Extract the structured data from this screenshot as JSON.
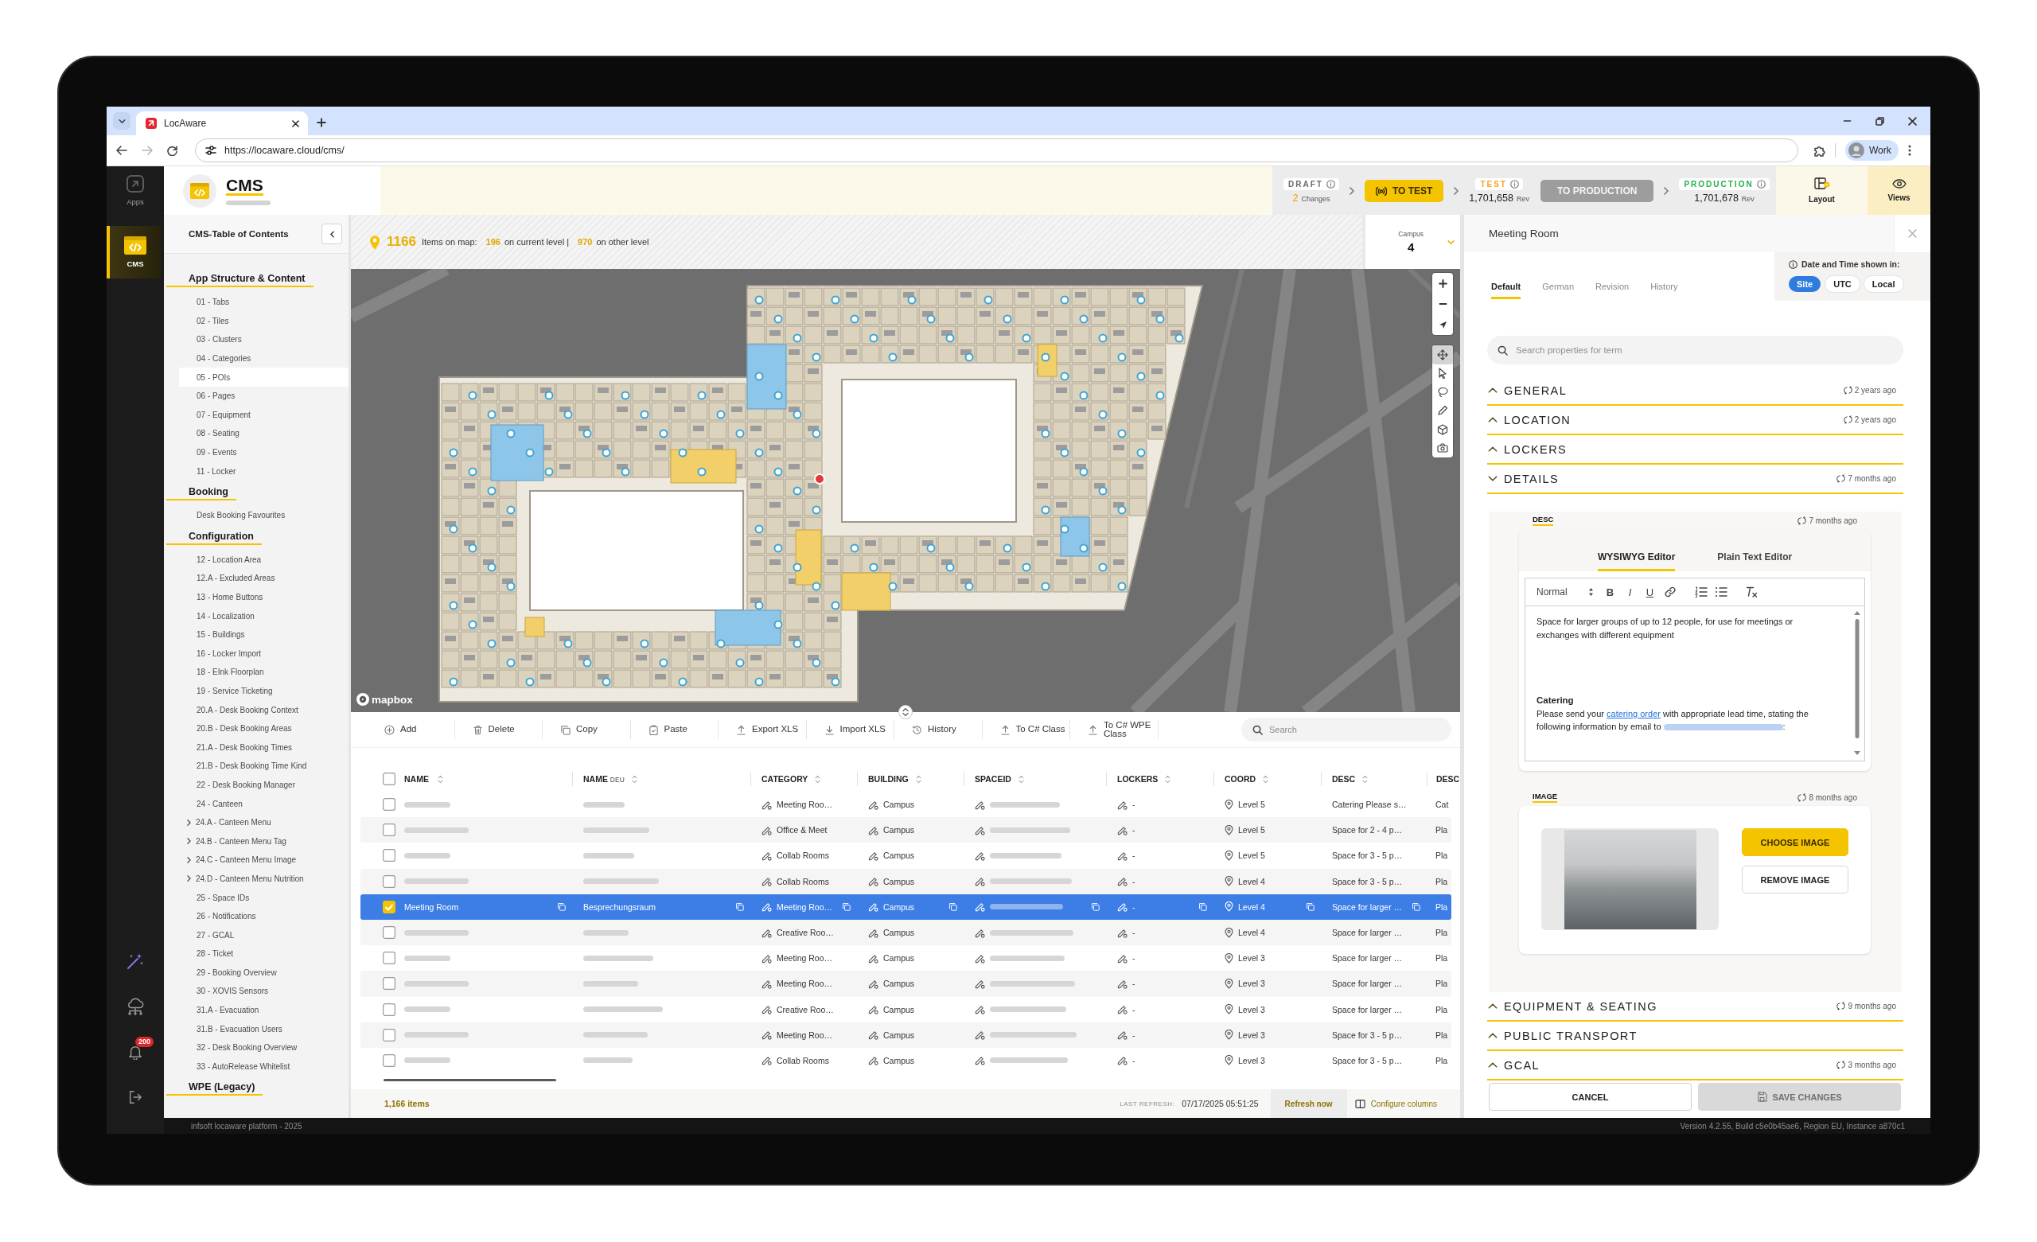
{
  "browser": {
    "tab": {
      "title": "LocAware"
    },
    "url": "https://locaware.cloud/cms/",
    "profile": "Work"
  },
  "rail": {
    "items": [
      {
        "label": "Apps",
        "selected": false
      },
      {
        "label": "CMS",
        "selected": true
      }
    ],
    "notifications": "200"
  },
  "header": {
    "title": "CMS",
    "pipeline": [
      {
        "kind": "stage",
        "label": "DRAFT",
        "color": "#6b6b6b",
        "value": "2",
        "highlighted": true,
        "unit": "Changes"
      },
      {
        "kind": "arrow"
      },
      {
        "kind": "action",
        "label": "TO TEST",
        "disabled": false
      },
      {
        "kind": "arrow"
      },
      {
        "kind": "stage",
        "label": "TEST",
        "color": "#f5a623",
        "value": "1,701,658",
        "highlighted": false,
        "unit": "Rev"
      },
      {
        "kind": "action",
        "label": "TO PRODUCTION",
        "disabled": true
      },
      {
        "kind": "arrow"
      },
      {
        "kind": "stage",
        "label": "PRODUCTION",
        "color": "#22b14c",
        "value": "1,701,678",
        "highlighted": false,
        "unit": "Rev"
      }
    ],
    "views": [
      {
        "label": "Layout",
        "selected": false
      },
      {
        "label": "Views",
        "selected": true
      }
    ]
  },
  "sidebar": {
    "title": "CMS-Table of Contents",
    "sections": [
      {
        "title": "App Structure & Content",
        "items": [
          {
            "label": "01 - Tabs",
            "selected": false
          },
          {
            "label": "02 - Tiles",
            "selected": false
          },
          {
            "label": "03 - Clusters",
            "selected": false
          },
          {
            "label": "04 - Categories",
            "selected": false
          },
          {
            "label": "05 - POIs",
            "selected": true
          },
          {
            "label": "06 - Pages",
            "selected": false
          },
          {
            "label": "07 - Equipment",
            "selected": false
          },
          {
            "label": "08 - Seating",
            "selected": false
          },
          {
            "label": "09 - Events",
            "selected": false
          },
          {
            "label": "11 - Locker",
            "selected": false
          }
        ]
      },
      {
        "title": "Booking",
        "items": [
          {
            "label": "Desk Booking Favourites",
            "selected": false
          }
        ]
      },
      {
        "title": "Configuration",
        "items": [
          {
            "label": "12 - Location Area",
            "selected": false,
            "expandable": false
          },
          {
            "label": "12.A - Excluded Areas",
            "selected": false,
            "expandable": false
          },
          {
            "label": "13 - Home Buttons",
            "selected": false,
            "expandable": false
          },
          {
            "label": "14 - Localization",
            "selected": false,
            "expandable": false
          },
          {
            "label": "15 - Buildings",
            "selected": false,
            "expandable": false
          },
          {
            "label": "16 - Locker Import",
            "selected": false,
            "expandable": false
          },
          {
            "label": "18 - EInk Floorplan",
            "selected": false,
            "expandable": false
          },
          {
            "label": "19 - Service Ticketing",
            "selected": false,
            "expandable": false
          },
          {
            "label": "20.A - Desk Booking Context",
            "selected": false,
            "expandable": false
          },
          {
            "label": "20.B - Desk Booking Areas",
            "selected": false,
            "expandable": false
          },
          {
            "label": "21.A - Desk Booking Times",
            "selected": false,
            "expandable": false
          },
          {
            "label": "21.B - Desk Booking Time Kind",
            "selected": false,
            "expandable": false
          },
          {
            "label": "22 - Desk Booking Manager",
            "selected": false,
            "expandable": false
          },
          {
            "label": "24 - Canteen",
            "selected": false,
            "expandable": false
          },
          {
            "label": "24.A - Canteen Menu",
            "selected": false,
            "expandable": true
          },
          {
            "label": "24.B - Canteen Menu Tag",
            "selected": false,
            "expandable": true
          },
          {
            "label": "24.C - Canteen Menu Image",
            "selected": false,
            "expandable": true
          },
          {
            "label": "24.D - Canteen Menu Nutrition",
            "selected": false,
            "expandable": true
          },
          {
            "label": "25 - Space IDs",
            "selected": false,
            "expandable": false
          },
          {
            "label": "26 - Notifications",
            "selected": false,
            "expandable": false
          },
          {
            "label": "27 - GCAL",
            "selected": false,
            "expandable": false
          },
          {
            "label": "28 - Ticket",
            "selected": false,
            "expandable": false
          },
          {
            "label": "29 - Booking Overview",
            "selected": false,
            "expandable": false
          },
          {
            "label": "30 - XOVIS Sensors",
            "selected": false,
            "expandable": false
          },
          {
            "label": "31.A - Evacuation",
            "selected": false,
            "expandable": false
          },
          {
            "label": "31.B - Evacuation Users",
            "selected": false,
            "expandable": false
          },
          {
            "label": "32 - Desk Booking Overview",
            "selected": false,
            "expandable": false
          },
          {
            "label": "33 - AutoRelease Whitelist",
            "selected": false,
            "expandable": false
          }
        ]
      },
      {
        "title": "WPE (Legacy)"
      }
    ]
  },
  "map": {
    "summary": {
      "count": "1166",
      "count_label": "Items on map:",
      "current": "196",
      "current_label": "on current level |",
      "other": "970",
      "other_label": "on other level"
    },
    "level_picker": {
      "label": "Campus",
      "value": "4"
    },
    "tools": [
      {
        "selected": true
      },
      {
        "selected": false
      },
      {
        "selected": false
      },
      {
        "selected": false
      },
      {
        "selected": false
      },
      {
        "selected": false
      }
    ],
    "attribution": "mapbox"
  },
  "toolbar": {
    "actions": [
      "Add",
      "Delete",
      "Copy",
      "Paste",
      "Export XLS",
      "Import XLS",
      "History",
      "To C# Class",
      "To C# WPE Class"
    ],
    "search": {
      "placeholder": "Search"
    }
  },
  "table": {
    "select_all": {
      "checked": false
    },
    "columns": [
      {
        "label": "NAME"
      },
      {
        "label": "NAME",
        "suffix": "DEU"
      },
      {
        "label": "CATEGORY"
      },
      {
        "label": "BUILDING"
      },
      {
        "label": "SPACEID"
      },
      {
        "label": "LOCKERS"
      },
      {
        "label": "COORD"
      },
      {
        "label": "DESC"
      },
      {
        "label": "DESC"
      }
    ],
    "rows": [
      {
        "selected": false,
        "category": "Meeting Roo…",
        "building": "Campus",
        "lockers": "-",
        "coord": "Level 5",
        "desc": "Catering Please s…",
        "desc_2": "Cat"
      },
      {
        "selected": false,
        "category": "Office & Meet",
        "building": "Campus",
        "lockers": "-",
        "coord": "Level 5",
        "desc": "Space for 2 - 4 p…",
        "desc_2": "Pla"
      },
      {
        "selected": false,
        "category": "Collab Rooms",
        "building": "Campus",
        "lockers": "-",
        "coord": "Level 5",
        "desc": "Space for 3 - 5 p…",
        "desc_2": "Pla"
      },
      {
        "selected": false,
        "category": "Collab Rooms",
        "building": "Campus",
        "lockers": "-",
        "coord": "Level 4",
        "desc": "Space for 3 - 5 p…",
        "desc_2": "Pla"
      },
      {
        "selected": true,
        "name": "Meeting Room",
        "name_deu": "Besprechungsraum",
        "category": "Meeting Roo…",
        "building": "Campus",
        "lockers": "-",
        "coord": "Level 4",
        "desc": "Space for larger …",
        "desc_2": "Pla"
      },
      {
        "selected": false,
        "category": "Creative Roo…",
        "building": "Campus",
        "lockers": "-",
        "coord": "Level 4",
        "desc": "Space for larger …",
        "desc_2": "Pla"
      },
      {
        "selected": false,
        "category": "Meeting Roo…",
        "building": "Campus",
        "lockers": "-",
        "coord": "Level 3",
        "desc": "Space for larger …",
        "desc_2": "Pla"
      },
      {
        "selected": false,
        "category": "Meeting Roo…",
        "building": "Campus",
        "lockers": "-",
        "coord": "Level 3",
        "desc": "Space for larger …",
        "desc_2": "Pla"
      },
      {
        "selected": false,
        "category": "Creative Roo…",
        "building": "Campus",
        "lockers": "-",
        "coord": "Level 3",
        "desc": "Space for larger …",
        "desc_2": "Pla"
      },
      {
        "selected": false,
        "category": "Meeting Roo…",
        "building": "Campus",
        "lockers": "-",
        "coord": "Level 3",
        "desc": "Space for 3 - 5 p…",
        "desc_2": "Pla"
      },
      {
        "selected": false,
        "category": "Collab Rooms",
        "building": "Campus",
        "lockers": "-",
        "coord": "Level 3",
        "desc": "Space for 3 - 5 p…",
        "desc_2": "Pla"
      }
    ],
    "footer": {
      "count": "1,166 items",
      "last_refresh_label": "LAST REFRESH:",
      "last_refresh": "07/17/2025 05:51:25",
      "refresh": "Refresh now",
      "configure": "Configure columns"
    }
  },
  "detail": {
    "title": "Meeting Room",
    "tabs": [
      {
        "label": "Default",
        "selected": true
      },
      {
        "label": "German",
        "selected": false
      },
      {
        "label": "Revision",
        "selected": false
      },
      {
        "label": "History",
        "selected": false
      }
    ],
    "time_zone": {
      "label": "Date and Time shown in:",
      "options": [
        {
          "label": "Site",
          "selected": true
        },
        {
          "label": "UTC",
          "selected": false
        },
        {
          "label": "Local",
          "selected": false
        }
      ]
    },
    "search": {
      "placeholder": "Search properties for term"
    },
    "sections": [
      {
        "title": "GENERAL",
        "expanded": false,
        "updated": "2 years ago"
      },
      {
        "title": "LOCATION",
        "expanded": false,
        "updated": "2 years ago"
      },
      {
        "title": "LOCKERS",
        "expanded": false
      },
      {
        "title": "DETAILS",
        "expanded": true,
        "updated": "7 months ago",
        "fields": [
          {
            "kind": "rich_text",
            "label": "DESC",
            "updated": "7 months ago",
            "editor_tabs": [
              {
                "label": "WYSIWYG Editor",
                "selected": true
              },
              {
                "label": "Plain Text Editor",
                "selected": false
              }
            ],
            "format": "Normal",
            "marks": [
              "B",
              "I",
              "U"
            ],
            "content": [
              {
                "kind": "paragraph",
                "parts": [
                  {
                    "text": "Space for larger groups of up to 12 people, for use for meetings or exchanges with different equipment"
                  }
                ]
              },
              {
                "kind": "heading",
                "parts": [
                  {
                    "text": "Catering"
                  }
                ]
              },
              {
                "kind": "paragraph",
                "parts": [
                  {
                    "text": "Please send your "
                  },
                  {
                    "kind": "link",
                    "text": "catering order"
                  },
                  {
                    "text": " with appropriate lead time, stating the following information by email to "
                  },
                  {
                    "kind": "redacted"
                  },
                  {
                    "text": ":"
                  }
                ]
              }
            ]
          },
          {
            "kind": "image",
            "label": "IMAGE",
            "updated": "8 months ago",
            "actions": [
              {
                "label": "CHOOSE IMAGE",
                "primary": true
              },
              {
                "label": "REMOVE IMAGE",
                "primary": false
              }
            ]
          }
        ]
      },
      {
        "title": "EQUIPMENT & SEATING",
        "expanded": false,
        "updated": "9 months ago"
      },
      {
        "title": "PUBLIC TRANSPORT",
        "expanded": false
      },
      {
        "title": "GCAL",
        "expanded": false,
        "updated": "3 months ago"
      }
    ],
    "actions": [
      {
        "label": "CANCEL",
        "disabled": false
      },
      {
        "label": "SAVE CHANGES",
        "disabled": true
      }
    ]
  },
  "status_bar": {
    "left": "infsoft locaware platform - 2025",
    "right": "Version 4.2.55, Build c5e0b45ae6, Region EU, Instance a870c1"
  }
}
